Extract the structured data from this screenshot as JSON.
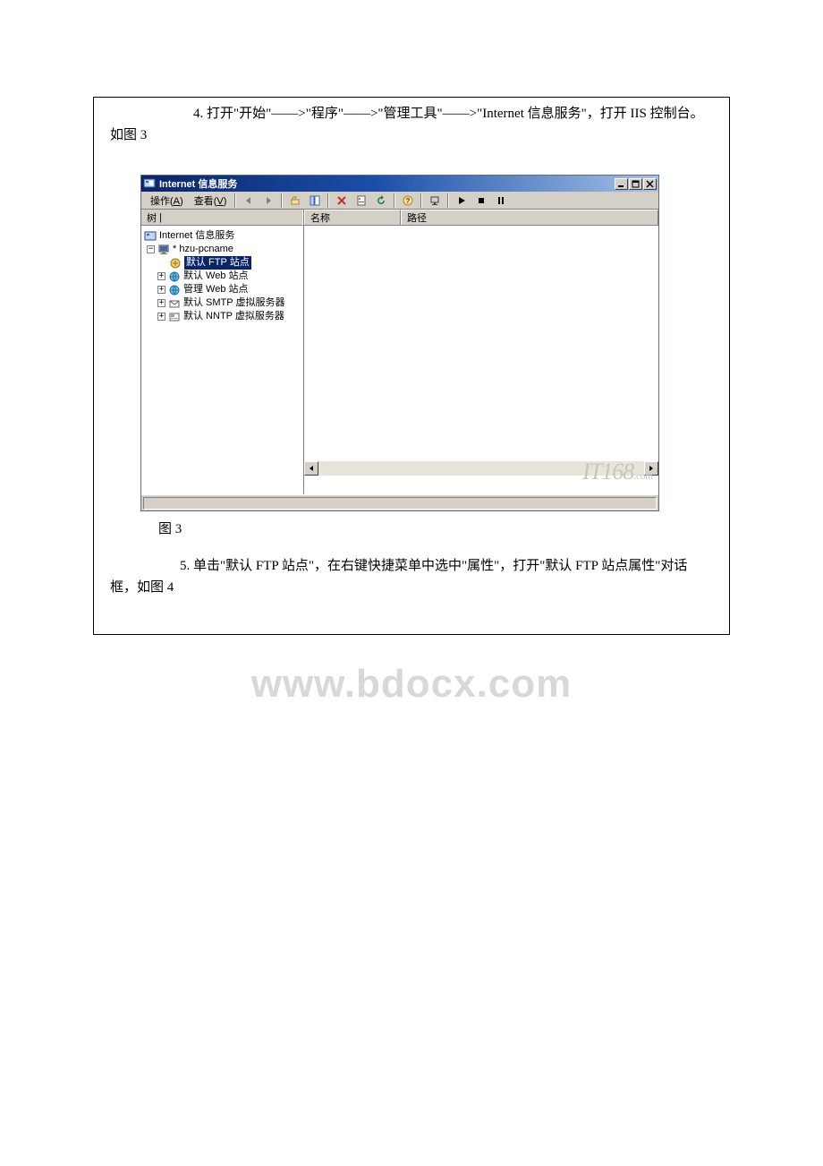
{
  "step4_text": "4. 打开\"开始\"——>\"程序\"——>\"管理工具\"——>\"Internet 信息服务\"，打开 IIS 控制台。如图 3",
  "figure3_label": "图 3",
  "step5_text": "5. 单击\"默认 FTP 站点\"，在右键快捷菜单中选中\"属性\"，打开\"默认 FTP 站点属性\"对话框，如图 4",
  "watermark_text": "www.bdocx.com",
  "win": {
    "title": "Internet 信息服务",
    "menu": {
      "action": "操作",
      "action_u": "A",
      "view": "查看",
      "view_u": "V"
    },
    "tree_header": "树",
    "col_name": "名称",
    "col_path": "路径",
    "tree": {
      "root": "Internet 信息服务",
      "host": "* hzu-pcname",
      "ftp": "默认 FTP 站点",
      "web": "默认 Web 站点",
      "admin": "管理 Web 站点",
      "smtp": "默认 SMTP 虚拟服务器",
      "nntp": "默认 NNTP 虚拟服务器"
    },
    "corner_logo": "IT168",
    "corner_suffix": ".com"
  }
}
